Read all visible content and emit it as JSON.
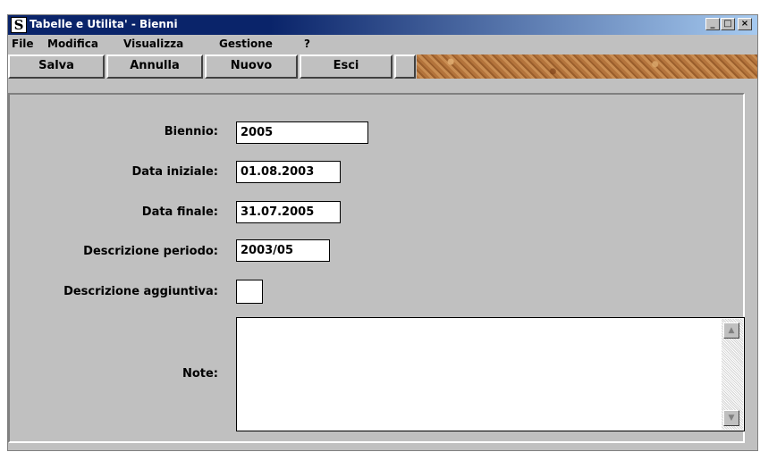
{
  "window": {
    "title": "Tabelle e Utilita' - Bienni",
    "app_icon": "S",
    "controls": {
      "minimize": "_",
      "maximize": "□",
      "close": "×"
    }
  },
  "menu": [
    "File",
    "Modifica",
    "Visualizza",
    "Gestione",
    "?"
  ],
  "toolbar": {
    "buttons": [
      "Salva",
      "Annulla",
      "Nuovo",
      "Esci"
    ]
  },
  "form": {
    "biennio": {
      "label": "Biennio:",
      "value": "2005"
    },
    "data_iniziale": {
      "label": "Data iniziale:",
      "value": "01.08.2003"
    },
    "data_finale": {
      "label": "Data finale:",
      "value": "31.07.2005"
    },
    "descrizione_periodo": {
      "label": "Descrizione periodo:",
      "value": "2003/05"
    },
    "descrizione_aggiuntiva": {
      "label": "Descrizione aggiuntiva:",
      "value": ""
    },
    "note": {
      "label": "Note:",
      "value": ""
    }
  },
  "icons": {
    "app": "app-logo-icon",
    "scroll_up": "scroll-up-arrow-icon",
    "scroll_down": "scroll-down-arrow-icon"
  },
  "colors": {
    "titlebar": "#0a246a",
    "face": "#c0c0c0",
    "input_bg": "#ffffff"
  }
}
